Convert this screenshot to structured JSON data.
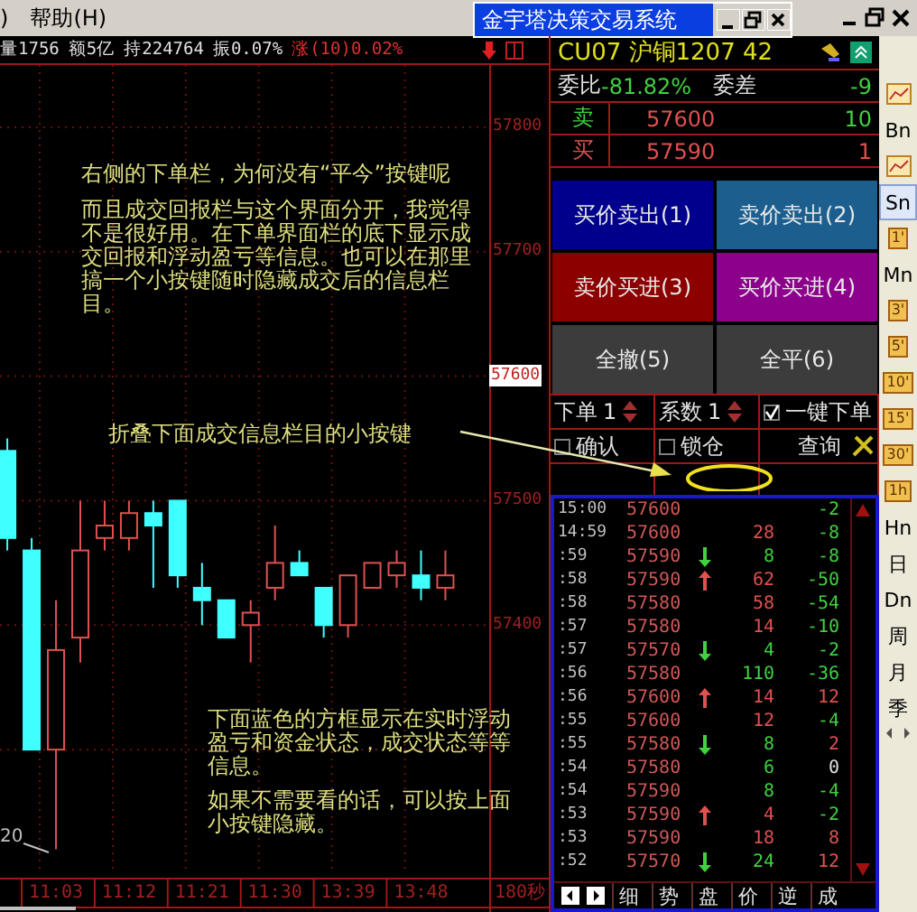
{
  "menu": {
    "items": [
      ")",
      "帮助(H)"
    ]
  },
  "popup": {
    "title": "金宇塔决策交易系统"
  },
  "info_bar": {
    "items": [
      {
        "text": "量1756",
        "kind": "plain"
      },
      {
        "text": "额5亿",
        "kind": "plain"
      },
      {
        "text": "持224764",
        "kind": "plain"
      },
      {
        "text": "振0.07%",
        "kind": "plain"
      },
      {
        "text": "涨(10)0.02%",
        "kind": "rise"
      }
    ]
  },
  "chart": {
    "current_price": "57600",
    "chart_data": {
      "type": "candlestick",
      "ylim": [
        57200,
        57850
      ],
      "grid": true,
      "yticks": [
        {
          "value": 57800,
          "label": "57800"
        },
        {
          "value": 57700,
          "label": "57700"
        },
        {
          "value": 57500,
          "label": "57500"
        },
        {
          "value": 57400,
          "label": "57400"
        }
      ],
      "categories": [
        null,
        null,
        "11:03",
        null,
        null,
        "11:12",
        null,
        null,
        "11:21",
        null,
        null,
        "11:30",
        null,
        null,
        "13:39",
        null,
        null,
        "13:48",
        null
      ],
      "ohlc": [
        [
          57540,
          57550,
          57460,
          57470
        ],
        [
          57460,
          57470,
          57300,
          57300
        ],
        [
          57300,
          57420,
          57220,
          57380
        ],
        [
          57390,
          57500,
          57370,
          57460
        ],
        [
          57470,
          57500,
          57460,
          57480
        ],
        [
          57470,
          57500,
          57460,
          57490
        ],
        [
          57490,
          57500,
          57430,
          57480
        ],
        [
          57500,
          57500,
          57430,
          57440
        ],
        [
          57430,
          57450,
          57400,
          57420
        ],
        [
          57420,
          57420,
          57390,
          57390
        ],
        [
          57400,
          57420,
          57370,
          57410
        ],
        [
          57430,
          57480,
          57420,
          57450
        ],
        [
          57450,
          57460,
          57440,
          57440
        ],
        [
          57430,
          57430,
          57390,
          57400
        ],
        [
          57400,
          57440,
          57390,
          57440
        ],
        [
          57430,
          57450,
          57430,
          57450
        ],
        [
          57440,
          57460,
          57430,
          57450
        ],
        [
          57440,
          57460,
          57420,
          57430
        ],
        [
          57430,
          57460,
          57420,
          57440
        ]
      ]
    },
    "period_label": "180秒",
    "value_label": "20"
  },
  "annotations": [
    {
      "kind": "title",
      "text": "右侧的下单栏，为何没有“平今”按键呢"
    },
    {
      "kind": "para",
      "text": "而且成交回报栏与这个界面分开，我觉得不是很好用。在下单界面栏的底下显示成交回报和浮动盈亏等信息。也可以在那里搞一个小按键随时隐藏成交后的信息栏目。"
    },
    {
      "kind": "fold",
      "text": "折叠下面成交信息栏目的小按键"
    },
    {
      "kind": "box1",
      "text": "下面蓝色的方框显示在实时浮动盈亏和资金状态，成交状态等等信息。"
    },
    {
      "kind": "box2",
      "text": "如果不需要看的话，可以按上面小按键隐藏。"
    }
  ],
  "quote": {
    "title": "CU07 沪铜1207 42",
    "ratio_label": "委比",
    "ratio": "-81.82%",
    "diff_label": "委差",
    "diff": "-9"
  },
  "book": [
    {
      "kind": "sell",
      "label": "卖",
      "price": "57600",
      "qty": "10"
    },
    {
      "kind": "buy",
      "label": "买",
      "price": "57590",
      "qty": "1"
    }
  ],
  "order_buttons": [
    {
      "label": "买价卖出(1)",
      "color": "#00008c"
    },
    {
      "label": "卖价卖出(2)",
      "color": "#1c5f8e"
    },
    {
      "label": "卖价买进(3)",
      "color": "#8c0000"
    },
    {
      "label": "买价买进(4)",
      "color": "#8c008c"
    },
    {
      "label": "全撤(5)",
      "color": "#3c3c3c"
    },
    {
      "label": "全平(6)",
      "color": "#3c3c3c"
    }
  ],
  "controls": {
    "lots_label": "下单",
    "lots": "1",
    "factor_label": "系数",
    "factor": "1",
    "query": "查询",
    "checks": [
      {
        "label": "一键下单",
        "checked": true
      },
      {
        "label": "确认",
        "checked": false
      },
      {
        "label": "锁仓",
        "checked": false
      }
    ]
  },
  "ticks": [
    {
      "kind": "plain",
      "time": "15:00",
      "price": "57600",
      "change": "-2"
    },
    {
      "kind": "plain",
      "time": "14:59",
      "price": "57600",
      "volume": "28",
      "buy": true,
      "change": "-8"
    },
    {
      "kind": "down",
      "time": ":59",
      "price": "57590",
      "volume": "8",
      "buy": false,
      "change": "-8"
    },
    {
      "kind": "up",
      "time": ":58",
      "price": "57590",
      "volume": "62",
      "buy": true,
      "change": "-50"
    },
    {
      "kind": "plain",
      "time": ":58",
      "price": "57580",
      "volume": "58",
      "buy": true,
      "change": "-54"
    },
    {
      "kind": "plain",
      "time": ":57",
      "price": "57580",
      "volume": "14",
      "buy": true,
      "change": "-10"
    },
    {
      "kind": "down",
      "time": ":57",
      "price": "57570",
      "volume": "4",
      "buy": false,
      "change": "-2"
    },
    {
      "kind": "plain",
      "time": ":56",
      "price": "57580",
      "volume": "110",
      "buy": false,
      "change": "-36"
    },
    {
      "kind": "up",
      "time": ":56",
      "price": "57600",
      "volume": "14",
      "buy": true,
      "change": "12"
    },
    {
      "kind": "plain",
      "time": ":55",
      "price": "57600",
      "volume": "12",
      "buy": true,
      "change": "-4"
    },
    {
      "kind": "down",
      "time": ":55",
      "price": "57580",
      "volume": "8",
      "buy": false,
      "change": "2"
    },
    {
      "kind": "plain",
      "time": ":54",
      "price": "57580",
      "volume": "6",
      "buy": false,
      "change": "0"
    },
    {
      "kind": "plain",
      "time": ":54",
      "price": "57590",
      "volume": "8",
      "buy": false,
      "change": "-4"
    },
    {
      "kind": "up",
      "time": ":53",
      "price": "57590",
      "volume": "4",
      "buy": true,
      "change": "-2"
    },
    {
      "kind": "plain",
      "time": ":53",
      "price": "57590",
      "volume": "18",
      "buy": true,
      "change": "8"
    },
    {
      "kind": "down",
      "time": ":52",
      "price": "57570",
      "volume": "24",
      "buy": false,
      "change": "12"
    }
  ],
  "tick_tabs": [
    "细",
    "势",
    "盘",
    "价",
    "逆",
    "成"
  ],
  "sidebar": {
    "items": [
      {
        "kind": "icon"
      },
      {
        "kind": "text",
        "label": "Bn",
        "selected": false
      },
      {
        "kind": "icon"
      },
      {
        "kind": "text",
        "label": "Sn",
        "selected": true
      },
      {
        "kind": "badge",
        "label": "1'"
      },
      {
        "kind": "text",
        "label": "Mn",
        "selected": false
      },
      {
        "kind": "badge",
        "label": "3'"
      },
      {
        "kind": "badge",
        "label": "5'"
      },
      {
        "kind": "badge",
        "label": "10'"
      },
      {
        "kind": "badge",
        "label": "15'"
      },
      {
        "kind": "badge",
        "label": "30'"
      },
      {
        "kind": "badge",
        "label": "1h"
      },
      {
        "kind": "text",
        "label": "Hn",
        "selected": false
      },
      {
        "kind": "text",
        "label": "日",
        "selected": false
      },
      {
        "kind": "text",
        "label": "Dn",
        "selected": false
      },
      {
        "kind": "text",
        "label": "周",
        "selected": false
      },
      {
        "kind": "text",
        "label": "月",
        "selected": false
      },
      {
        "kind": "text",
        "label": "季",
        "selected": false
      }
    ]
  }
}
